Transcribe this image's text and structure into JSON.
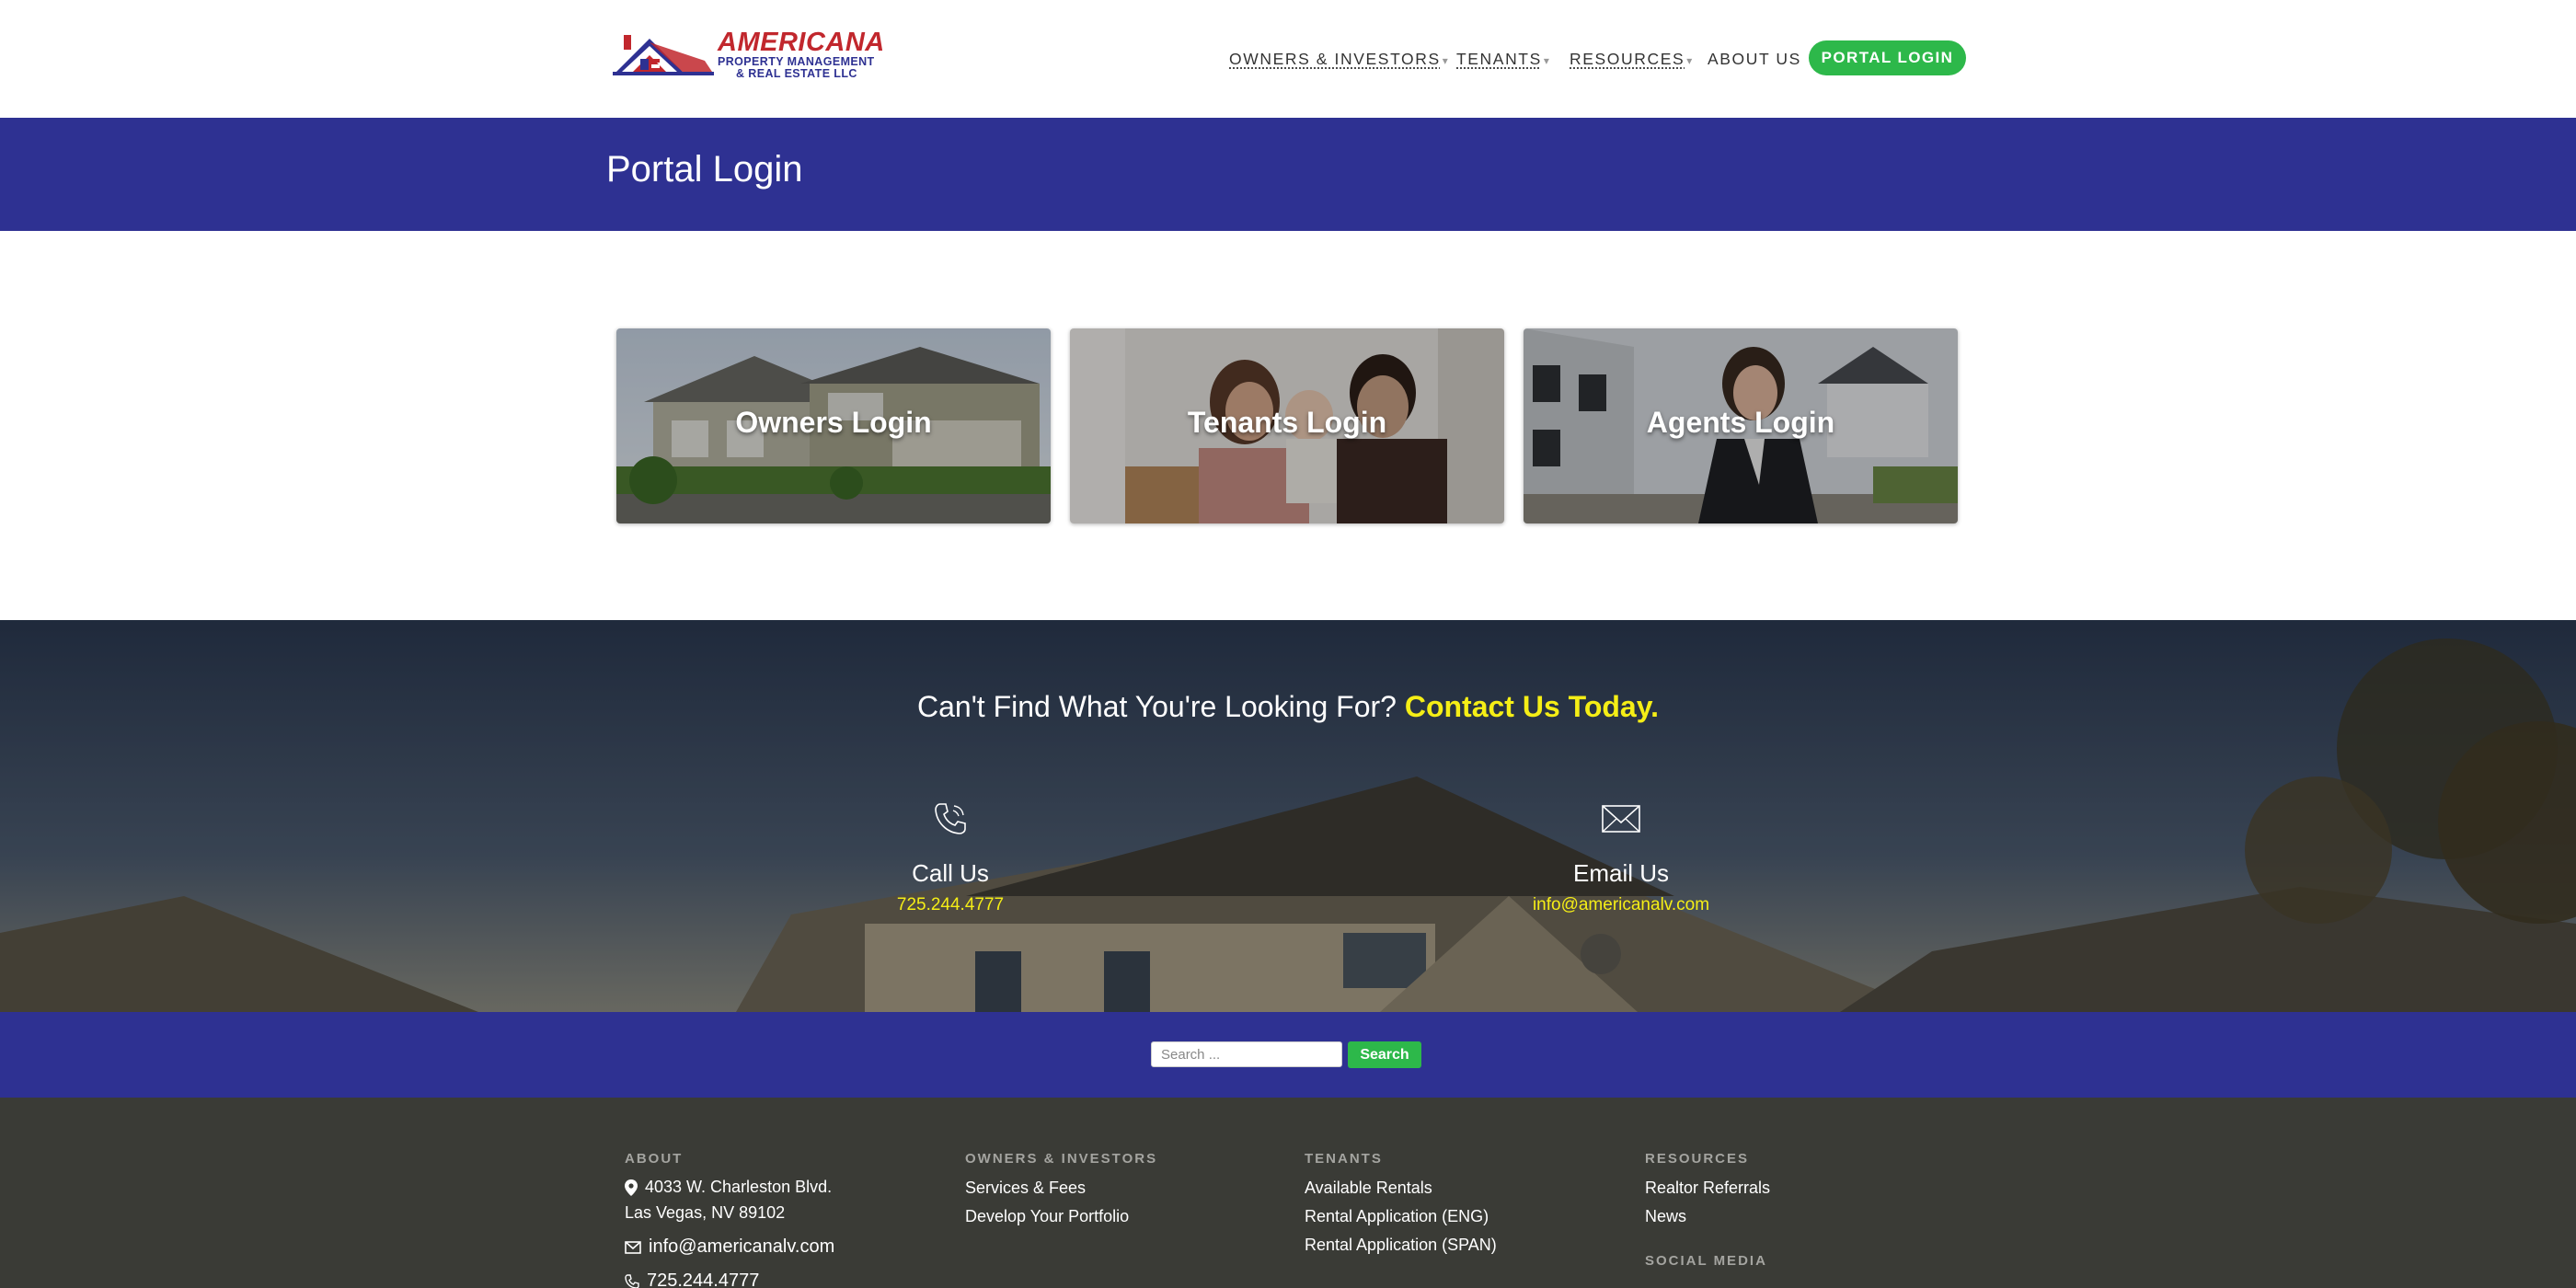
{
  "brand": {
    "name": "AMERICANA",
    "subtitle_line1": "PROPERTY MANAGEMENT",
    "subtitle_line2": "& REAL ESTATE LLC",
    "colors": {
      "red": "#c1272d",
      "blue": "#2e3192"
    }
  },
  "nav": {
    "items": [
      {
        "label": "OWNERS & INVESTORS",
        "has_dropdown": true
      },
      {
        "label": "TENANTS",
        "has_dropdown": true
      },
      {
        "label": "RESOURCES",
        "has_dropdown": true
      },
      {
        "label": "ABOUT US",
        "has_dropdown": false
      }
    ],
    "caret": "▾",
    "portal_button": "PORTAL LOGIN"
  },
  "page": {
    "title": "Portal Login"
  },
  "login_cards": [
    {
      "label": "Owners Login"
    },
    {
      "label": "Tenants Login"
    },
    {
      "label": "Agents Login"
    }
  ],
  "contact": {
    "headline_prefix": "Can't Find What You're Looking For?",
    "headline_highlight": "Contact Us Today.",
    "call": {
      "heading": "Call Us",
      "value": "725.244.4777",
      "icon": "phone-icon"
    },
    "email": {
      "heading": "Email Us",
      "value": "info@americanalv.com",
      "icon": "envelope-icon"
    },
    "highlight_color": "#f5ee16"
  },
  "search": {
    "placeholder": "Search ...",
    "value": "",
    "button": "Search"
  },
  "footer": {
    "about": {
      "heading": "ABOUT",
      "address_line1": "4033 W. Charleston Blvd.",
      "address_line2": "Las Vegas, NV 89102",
      "email": "info@americanalv.com",
      "phone": "725.244.4777"
    },
    "owners": {
      "heading": "OWNERS & INVESTORS",
      "links": [
        "Services & Fees",
        "Develop Your Portfolio"
      ]
    },
    "tenants": {
      "heading": "TENANTS",
      "links": [
        "Available Rentals",
        "Rental Application (ENG)",
        "Rental Application (SPAN)"
      ]
    },
    "resources": {
      "heading": "RESOURCES",
      "links": [
        "Realtor Referrals",
        "News"
      ],
      "social_heading": "SOCIAL MEDIA"
    }
  }
}
